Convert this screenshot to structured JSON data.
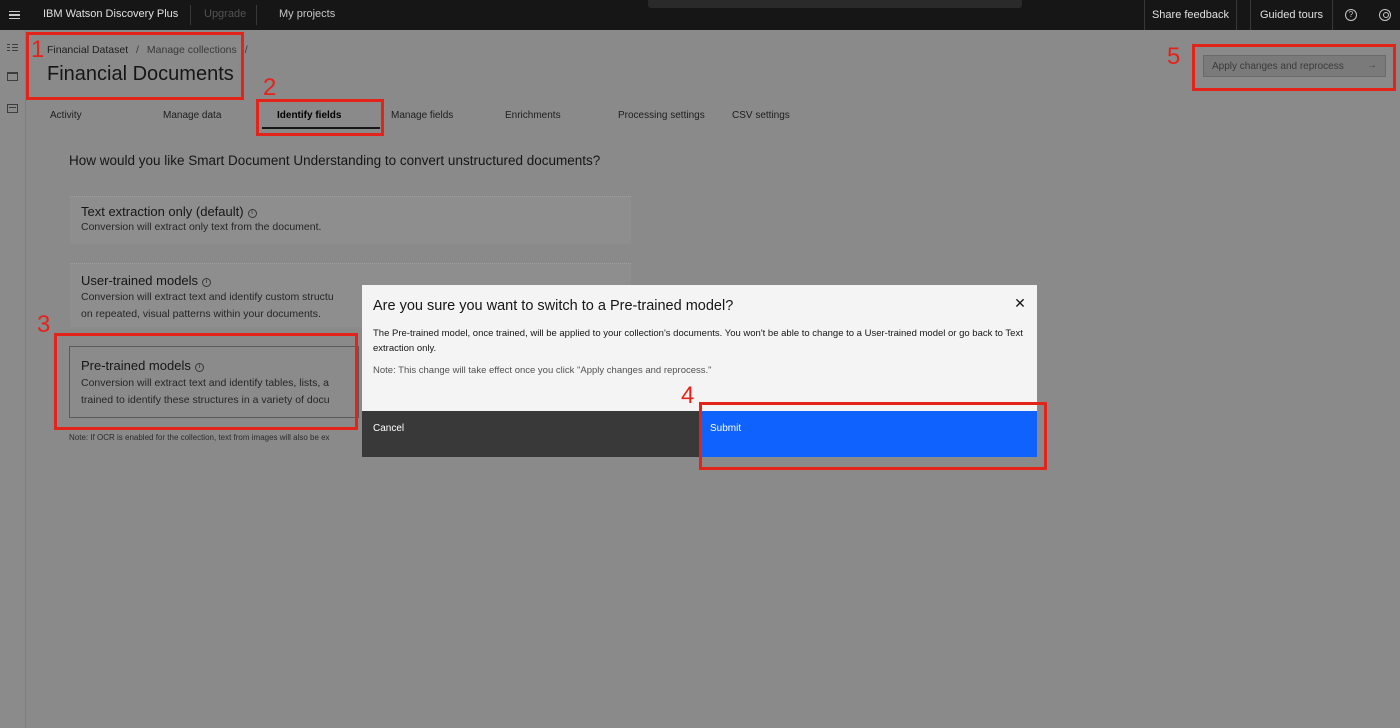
{
  "header": {
    "product_name": "IBM Watson Discovery Plus",
    "upgrade_label": "Upgrade",
    "projects_label": "My projects",
    "share_feedback_label": "Share feedback",
    "guided_tours_label": "Guided tours",
    "help_glyph": "?",
    "icons": [
      "menu-icon",
      "help-icon",
      "user-icon"
    ]
  },
  "sidebar": {
    "icons": [
      "project-overview-icon",
      "manage-collections-icon",
      "improve-customize-icon"
    ]
  },
  "breadcrumb": {
    "items": [
      "Financial Dataset",
      "Manage collections"
    ],
    "separator": "/"
  },
  "page": {
    "title": "Financial Documents",
    "apply_button_label": "Apply changes and reprocess"
  },
  "tabs": [
    {
      "label": "Activity",
      "active": false
    },
    {
      "label": "Manage data",
      "active": false
    },
    {
      "label": "Identify fields",
      "active": true
    },
    {
      "label": "Manage fields",
      "active": false
    },
    {
      "label": "Enrichments",
      "active": false
    },
    {
      "label": "Processing settings",
      "active": false
    },
    {
      "label": "CSV settings",
      "active": false
    }
  ],
  "content": {
    "question": "How would you like Smart Document Understanding to convert unstructured documents?",
    "options": [
      {
        "title": "Text extraction only (default)",
        "description": "Conversion will extract only text from the document.",
        "selected": false
      },
      {
        "title": "User-trained models",
        "description": "Conversion will extract text and identify custom structu",
        "description_line2": "on repeated, visual patterns within your documents.",
        "selected": false
      },
      {
        "title": "Pre-trained models",
        "description": "Conversion will extract text and identify tables, lists, a",
        "description_line2": "trained to identify these structures in a variety of docu",
        "selected": true
      }
    ],
    "ocr_note": "Note: If OCR is enabled for the collection, text from images will also be ex",
    "info_glyph": "i"
  },
  "modal": {
    "title": "Are you sure you want to switch to a Pre-trained model?",
    "close_glyph": "✕",
    "body": "The Pre-trained model, once trained, will be applied to your collection's documents. You won't be able to change to a User-trained model or go back to Text extraction only.",
    "note": "Note: This change will take effect once you click \"Apply changes and reprocess.\"",
    "cancel_label": "Cancel",
    "submit_label": "Submit"
  },
  "annotations": [
    "1",
    "2",
    "3",
    "4",
    "5"
  ],
  "colors": {
    "annotation": "#e3241b",
    "primary_button": "#0f62fe",
    "secondary_button": "#393939",
    "topbar": "#161616",
    "overlay": "#8a8a8a"
  }
}
